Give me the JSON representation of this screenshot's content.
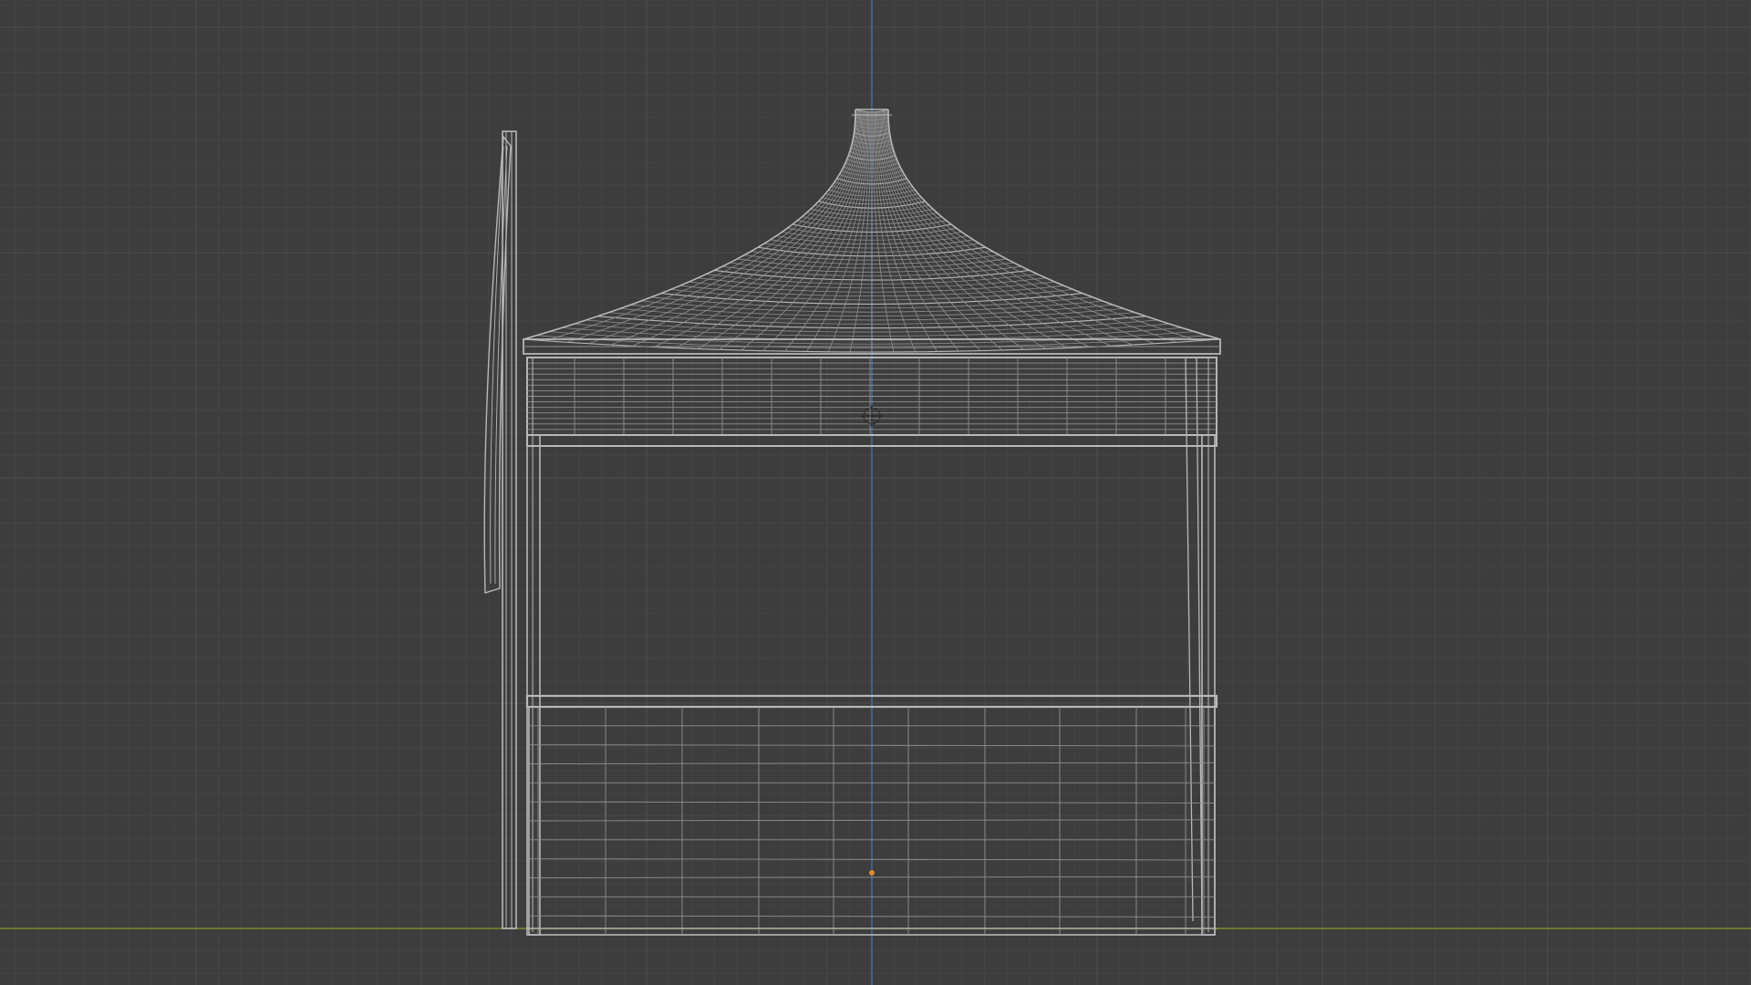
{
  "viewport": {
    "background_color": "#3d3d3d",
    "grid_minor_color": "#454545",
    "grid_major_color": "#4c4c4c",
    "axis_x_color": "#7a8a2e",
    "axis_z_color": "#3f6fa8",
    "wire_color": "#b8b8b8",
    "wire_dim_color": "#8f8f8f",
    "origin_color": "#e08a2a",
    "object_origin_icon": "empty-crosshair-icon"
  }
}
